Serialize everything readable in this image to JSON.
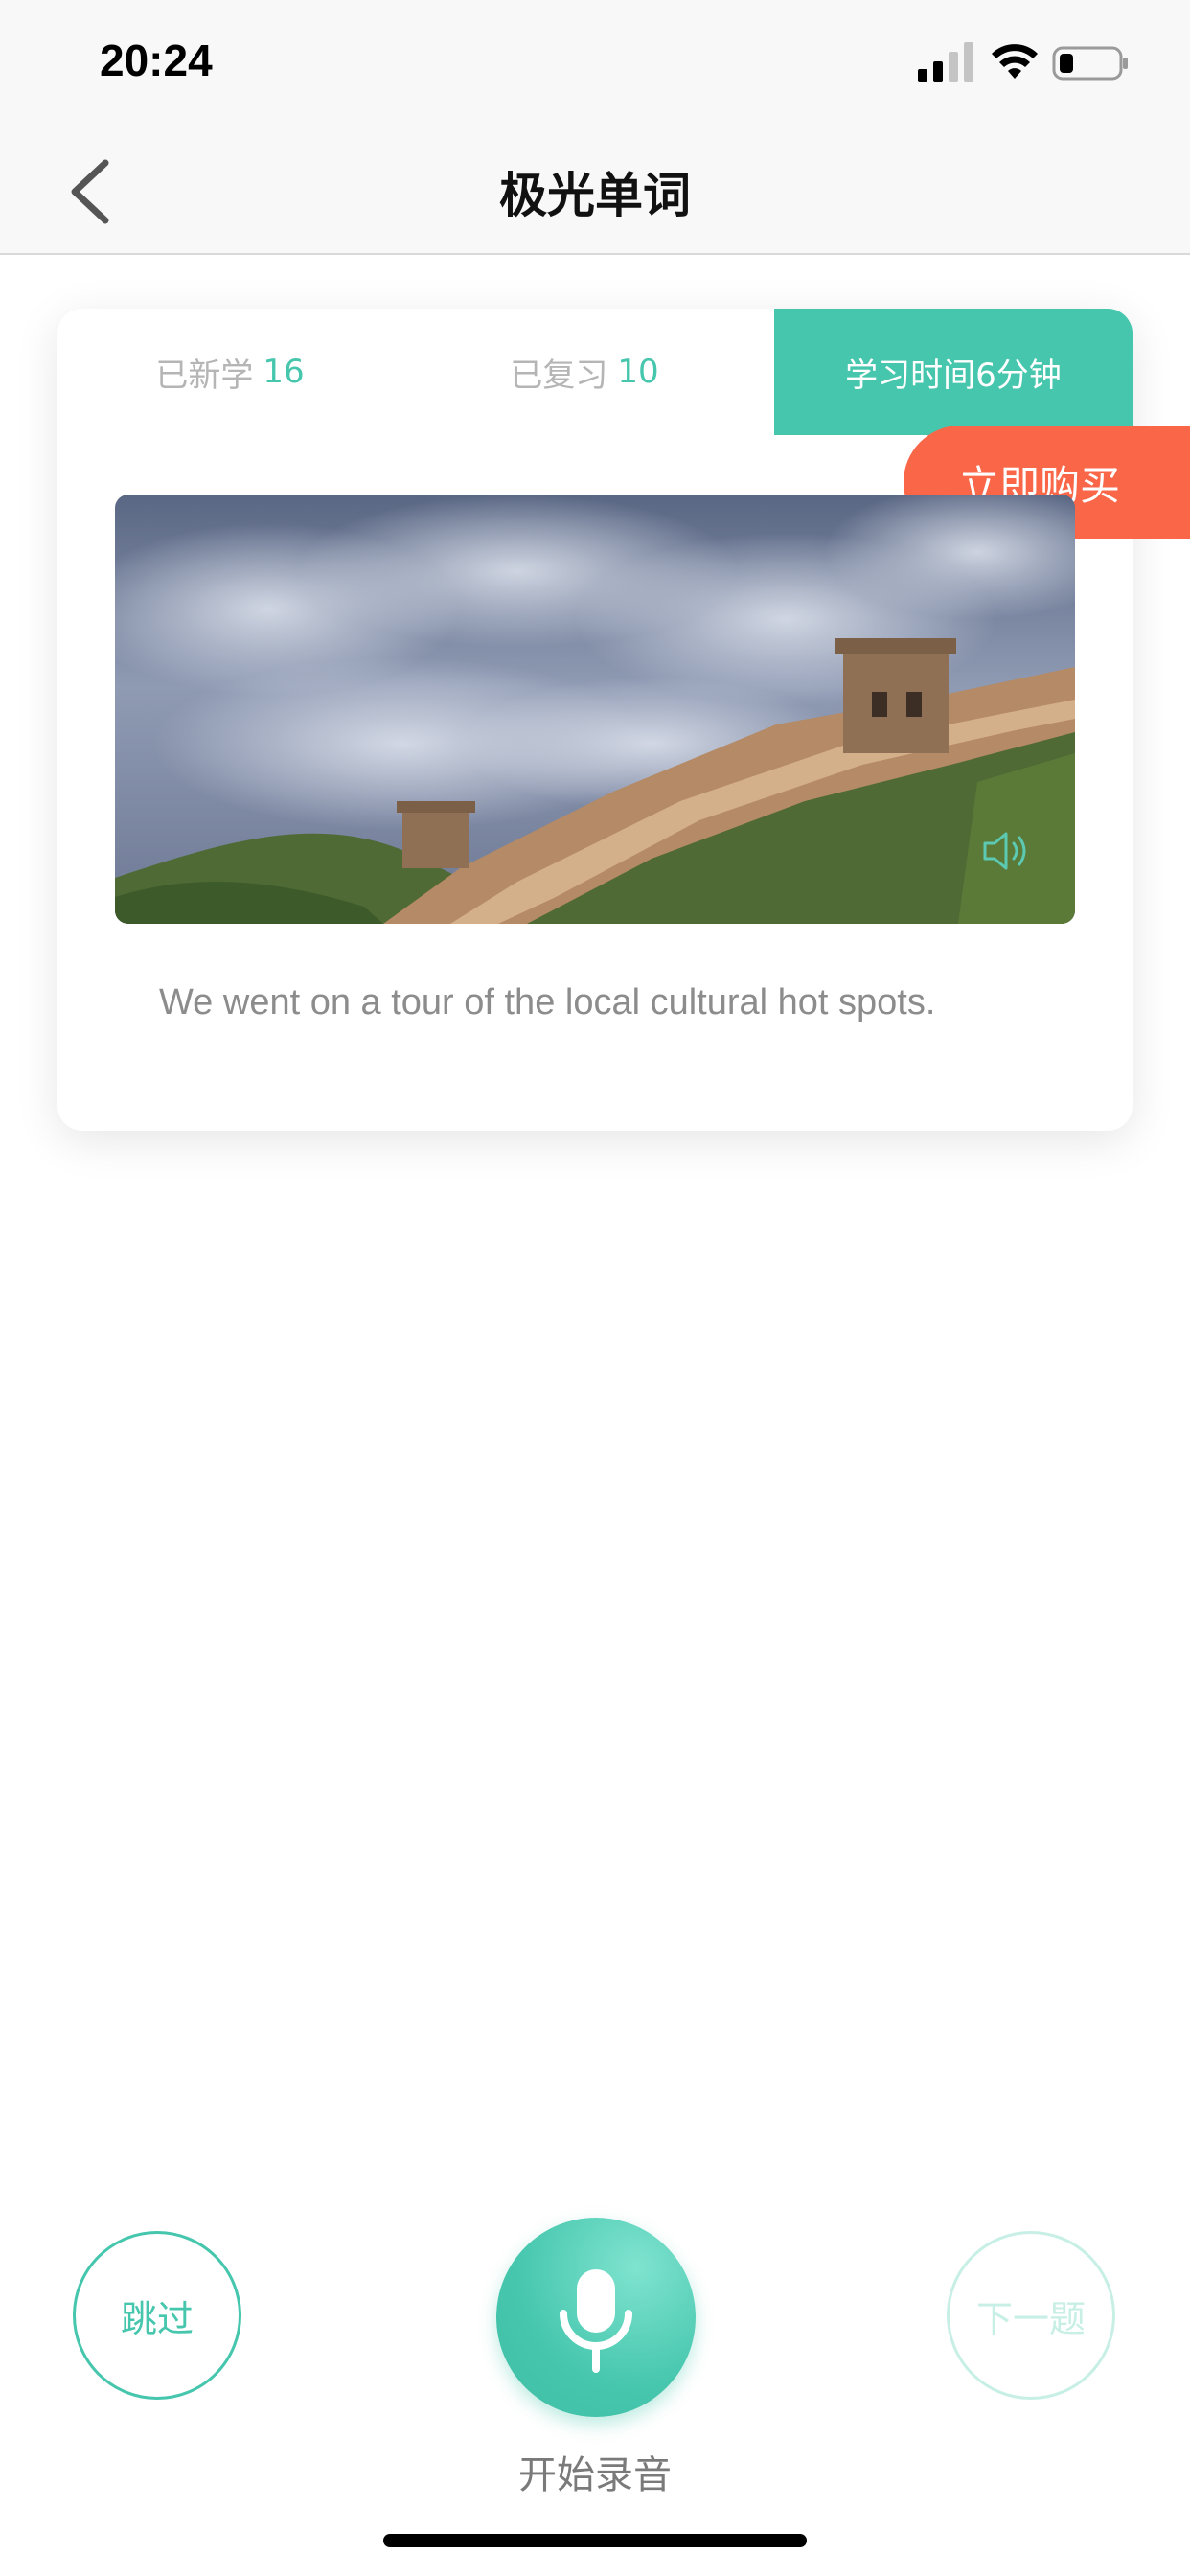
{
  "status_bar": {
    "time": "20:24"
  },
  "nav": {
    "title": "极光单词"
  },
  "stats": {
    "new_label": "已新学",
    "new_count": "16",
    "review_label": "已复习",
    "review_count": "10",
    "study_time": "学习时间6分钟"
  },
  "promo": {
    "buy_label": "立即购买"
  },
  "card": {
    "sentence": "We went on a tour of the local cultural hot spots."
  },
  "controls": {
    "skip_label": "跳过",
    "next_label": "下一题",
    "record_label": "开始录音"
  },
  "colors": {
    "accent": "#45c6ad",
    "buy": "#fa6648",
    "next_disabled": "#c7efe6"
  }
}
